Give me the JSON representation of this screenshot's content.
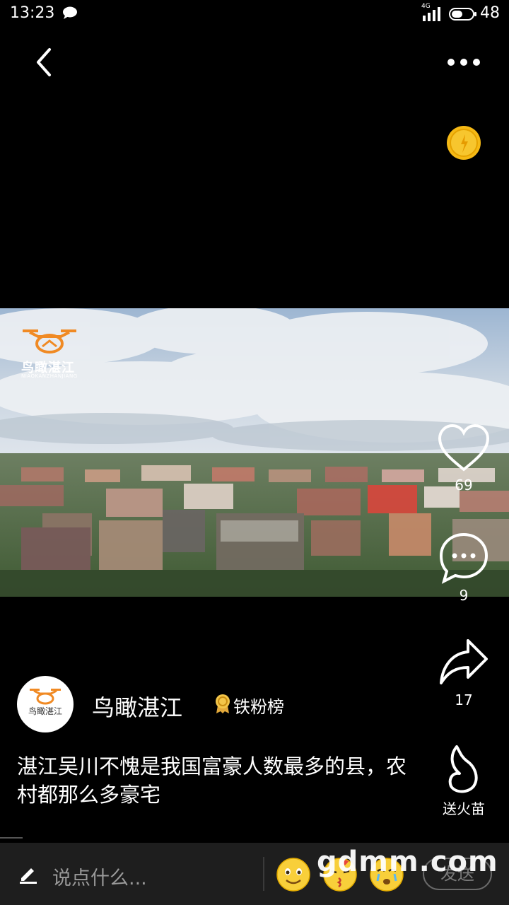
{
  "status_bar": {
    "time": "13:23",
    "network": "4G",
    "battery": "48"
  },
  "video": {
    "watermark_title": "鸟瞰湛江",
    "watermark_sub": "NIAOKANZHANJIANG"
  },
  "actions": {
    "like_count": "69",
    "comment_count": "9",
    "share_count": "17",
    "fire_label": "送火苗"
  },
  "author": {
    "name": "鸟瞰湛江",
    "badge": "铁粉榜",
    "avatar_text": "鸟瞰湛江"
  },
  "caption": "湛江吴川不愧是我国富豪人数最多的县，农村都那么多豪宅",
  "comment_bar": {
    "placeholder": "说点什么...",
    "send_label": "发送"
  },
  "site_watermark": "gdmm.com",
  "colors": {
    "background": "#000000",
    "logo_orange": "#f08a24",
    "coin_gold": "#f5b915",
    "bar_background": "#1e1e1e"
  }
}
